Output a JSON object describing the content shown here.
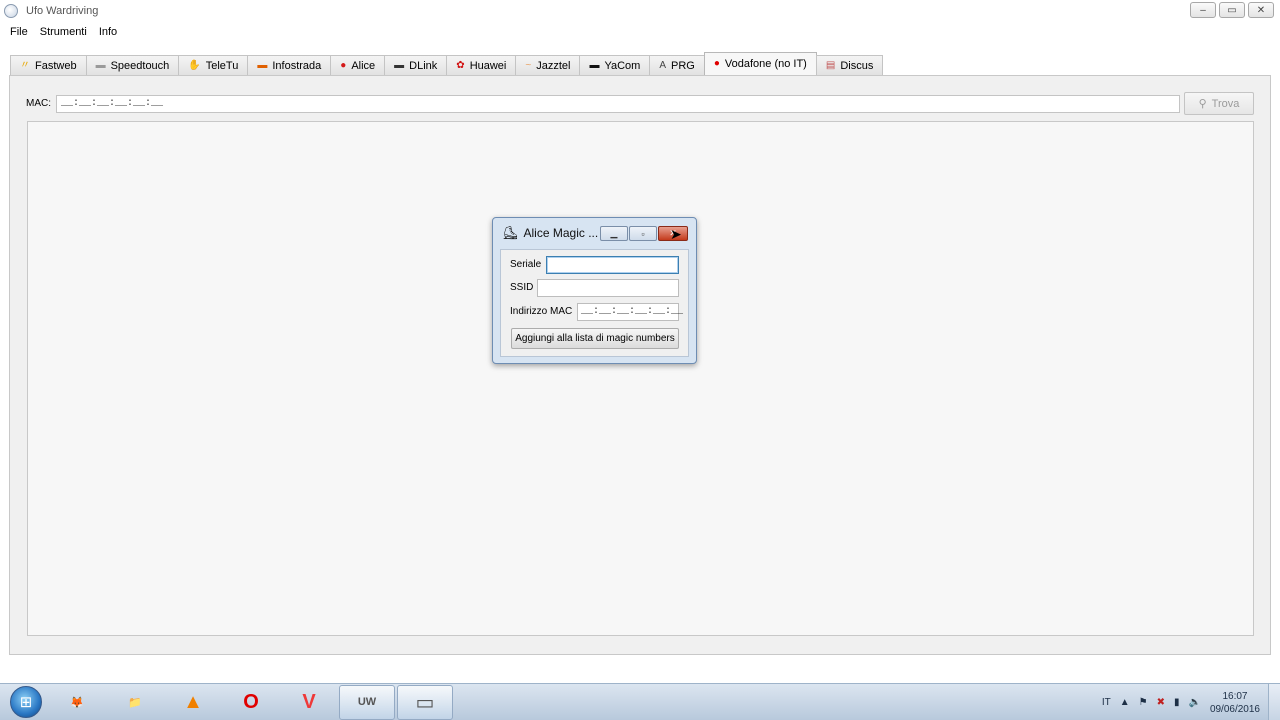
{
  "window": {
    "title": "Ufo Wardriving",
    "controls": [
      "–",
      "▭",
      "✕"
    ]
  },
  "menu": [
    "File",
    "Strumenti",
    "Info"
  ],
  "tabs": [
    {
      "label": "Fastweb",
      "icon": "fastweb-icon",
      "glyph": "〃",
      "color": "#e8a800"
    },
    {
      "label": "Speedtouch",
      "icon": "speedtouch-icon",
      "glyph": "▬",
      "color": "#9a9a9a"
    },
    {
      "label": "TeleTu",
      "icon": "teletu-icon",
      "glyph": "✋",
      "color": "#e0b400"
    },
    {
      "label": "Infostrada",
      "icon": "infostrada-icon",
      "glyph": "▬",
      "color": "#e06000"
    },
    {
      "label": "Alice",
      "icon": "alice-icon",
      "glyph": "●",
      "color": "#d41a1a"
    },
    {
      "label": "DLink",
      "icon": "dlink-icon",
      "glyph": "▬",
      "color": "#333333"
    },
    {
      "label": "Huawei",
      "icon": "huawei-icon",
      "glyph": "✿",
      "color": "#d01010"
    },
    {
      "label": "Jazztel",
      "icon": "jazztel-icon",
      "glyph": "~",
      "color": "#e8a060"
    },
    {
      "label": "YaCom",
      "icon": "yacom-icon",
      "glyph": "▬",
      "color": "#111111"
    },
    {
      "label": "PRG",
      "icon": "prg-icon",
      "glyph": "A",
      "color": "#444444"
    },
    {
      "label": "Vodafone (no IT)",
      "icon": "vodafone-icon",
      "glyph": "●",
      "color": "#e00000",
      "active": true
    },
    {
      "label": "Discus",
      "icon": "discus-icon",
      "glyph": "▤",
      "color": "#c05050"
    }
  ],
  "mac": {
    "label": "MAC:",
    "value": "__:__:__:__:__:__"
  },
  "trova": {
    "label": "Trova",
    "icon": "search-person-icon"
  },
  "dialog": {
    "title": "Alice Magic ...",
    "seriale_label": "Seriale",
    "seriale_value": "",
    "ssid_label": "SSID",
    "ssid_value": "",
    "mac_label": "Indirizzo MAC",
    "mac_value": "__:__:__:__:__:__",
    "action_label": "Aggiungi alla lista di magic numbers"
  },
  "taskbar": {
    "apps": [
      {
        "name": "firefox",
        "glyph": "🦊",
        "color": "#e66000"
      },
      {
        "name": "explorer",
        "glyph": "📁",
        "color": "#e6c060"
      },
      {
        "name": "vlc",
        "glyph": "▲",
        "color": "#f08000"
      },
      {
        "name": "opera",
        "glyph": "O",
        "color": "#e00000"
      },
      {
        "name": "vivaldi",
        "glyph": "V",
        "color": "#ef3939"
      },
      {
        "name": "ufo-wardriving",
        "glyph": "UW",
        "color": "#555555",
        "open": true
      },
      {
        "name": "window-app",
        "glyph": "▭",
        "color": "#555555",
        "open": true
      }
    ],
    "language": "IT",
    "time": "16:07",
    "date": "09/06/2016"
  }
}
